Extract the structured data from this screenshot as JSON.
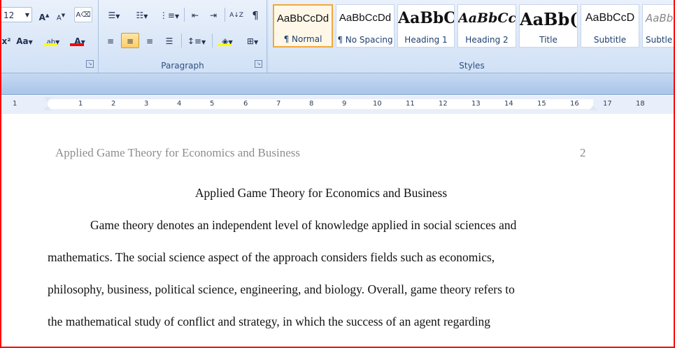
{
  "font": {
    "size_value": "12",
    "increase_label": "A",
    "decrease_label": "A",
    "case_label": "Aa",
    "highlight_label": "ab",
    "color_label": "A",
    "strike_label": "x²"
  },
  "paragraph": {
    "group_label": "Paragraph",
    "sort_label": "A↓Z",
    "pilcrow": "¶"
  },
  "styles": {
    "group_label": "Styles",
    "items": [
      {
        "preview": "AaBbCcDd",
        "name": "¶ Normal"
      },
      {
        "preview": "AaBbCcDd",
        "name": "¶ No Spacing"
      },
      {
        "preview": "AaBbC",
        "name": "Heading 1"
      },
      {
        "preview": "AaBbCc",
        "name": "Heading 2"
      },
      {
        "preview": "AaBb(",
        "name": "Title"
      },
      {
        "preview": "AaBbCcD",
        "name": "Subtitle"
      },
      {
        "preview": "AaBb",
        "name": "Subtle"
      }
    ]
  },
  "ruler": {
    "labels": [
      "1",
      "1",
      "2",
      "3",
      "4",
      "5",
      "6",
      "7",
      "8",
      "9",
      "10",
      "11",
      "12",
      "13",
      "14",
      "15",
      "16",
      "17",
      "18"
    ]
  },
  "document": {
    "running_header": "Applied Game Theory for Economics and Business",
    "page_number": "2",
    "title": "Applied Game Theory for Economics and Business",
    "lines": [
      "Game theory denotes an independent level of knowledge applied in social sciences and",
      "mathematics. The social science aspect of the approach considers fields such as economics,",
      "philosophy, business, political science, engineering, and biology. Overall, game theory refers to",
      "the mathematical study of conflict and strategy, in which the success of an agent regarding"
    ]
  },
  "colors": {
    "highlight": "#ffff00",
    "font_color": "#ff0000",
    "active_style_border": "#f1a83d",
    "ribbon_blue": "#c8daf3"
  }
}
